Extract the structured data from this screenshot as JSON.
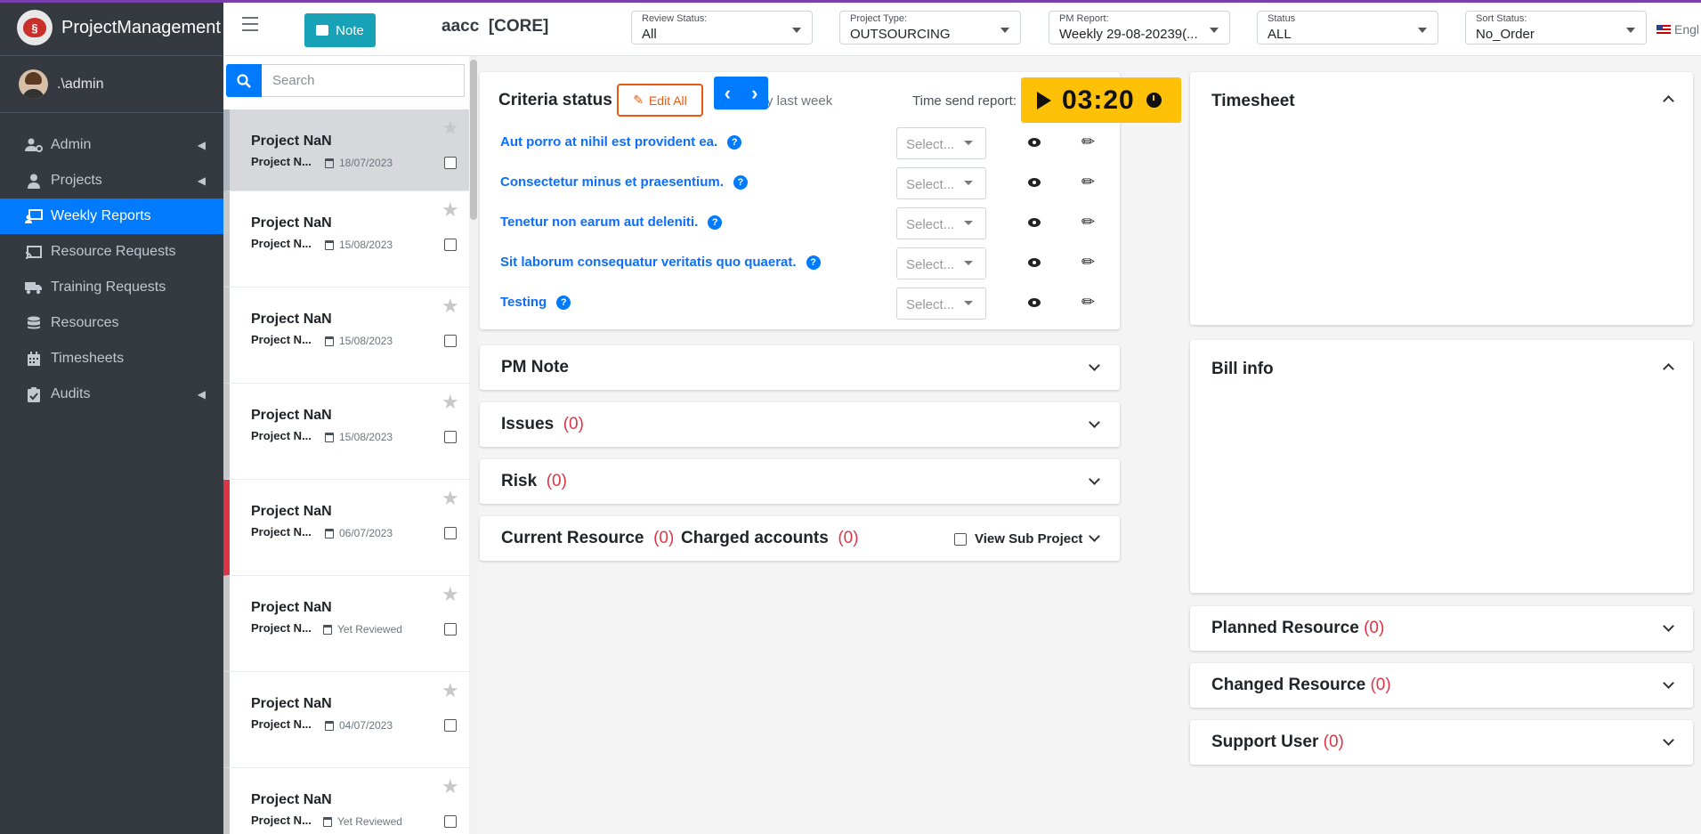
{
  "app": {
    "name": "ProjectManagement"
  },
  "user": {
    "name": ".\\admin"
  },
  "sidebar": {
    "items": [
      {
        "label": "Admin",
        "icon": "users-cog-icon",
        "caret": true,
        "active": false
      },
      {
        "label": "Projects",
        "icon": "user-tie-icon",
        "caret": true,
        "active": false
      },
      {
        "label": "Weekly Reports",
        "icon": "chalkboard-teacher-icon",
        "caret": false,
        "active": true
      },
      {
        "label": "Resource Requests",
        "icon": "cast-icon",
        "caret": false,
        "active": false
      },
      {
        "label": "Training Requests",
        "icon": "truck-icon",
        "caret": false,
        "active": false
      },
      {
        "label": "Resources",
        "icon": "database-icon",
        "caret": false,
        "active": false
      },
      {
        "label": "Timesheets",
        "icon": "calendar-icon",
        "caret": false,
        "active": false
      },
      {
        "label": "Audits",
        "icon": "clipboard-check-icon",
        "caret": true,
        "active": false
      }
    ]
  },
  "topbar": {
    "note_label": "Note",
    "project_title": "aacc  [CORE]",
    "filters": [
      {
        "label": "Review Status:",
        "value": "All"
      },
      {
        "label": "Project Type:",
        "value": "OUTSOURCING"
      },
      {
        "label": "PM Report:",
        "value": "Weekly 29-08-20239(..."
      },
      {
        "label": "Status",
        "value": "ALL"
      },
      {
        "label": "Sort Status:",
        "value": "No_Order"
      }
    ],
    "language": "Engl"
  },
  "search": {
    "placeholder": "Search"
  },
  "projects": [
    {
      "name": "Project NaN",
      "sub": "Project N...",
      "date": "18/07/2023",
      "selected": true,
      "flag": "grey"
    },
    {
      "name": "Project NaN",
      "sub": "Project N...",
      "date": "15/08/2023",
      "selected": false,
      "flag": "grey"
    },
    {
      "name": "Project NaN",
      "sub": "Project N...",
      "date": "15/08/2023",
      "selected": false,
      "flag": "grey"
    },
    {
      "name": "Project NaN",
      "sub": "Project N...",
      "date": "15/08/2023",
      "selected": false,
      "flag": "grey"
    },
    {
      "name": "Project NaN",
      "sub": "Project N...",
      "date": "06/07/2023",
      "selected": false,
      "flag": "red"
    },
    {
      "name": "Project NaN",
      "sub": "Project N...",
      "date": "Yet Reviewed",
      "selected": false,
      "flag": "grey"
    },
    {
      "name": "Project NaN",
      "sub": "Project N...",
      "date": "04/07/2023",
      "selected": false,
      "flag": "grey"
    },
    {
      "name": "Project NaN",
      "sub": "Project N...",
      "date": "Yet Reviewed",
      "selected": false,
      "flag": "grey"
    }
  ],
  "criteria": {
    "title": "Criteria status",
    "edit_all": "Edit All",
    "last_week": "y last week",
    "time_send_label": "Time send report:",
    "timer": "03:20",
    "select_placeholder": "Select...",
    "rows": [
      "Aut porro at nihil est provident ea.",
      "Consectetur minus et praesentium.",
      "Tenetur non earum aut deleniti.",
      "Sit laborum consequatur veritatis quo quaerat.",
      "Testing"
    ]
  },
  "sections": {
    "pm_note": "PM Note",
    "issues": "Issues",
    "issues_count": "(0)",
    "risk": "Risk",
    "risk_count": "(0)",
    "current_resource": "Current Resource",
    "current_resource_count": "(0)",
    "charged_accounts": "Charged accounts",
    "charged_accounts_count": "(0)",
    "view_sub_project": "View Sub Project"
  },
  "right": {
    "timesheet": "Timesheet",
    "bill_info": "Bill info",
    "planned_resource": "Planned Resource",
    "planned_resource_count": "(0)",
    "changed_resource": "Changed Resource",
    "changed_resource_count": "(0)",
    "support_user": "Support User",
    "support_user_count": "(0)"
  },
  "colors": {
    "primary": "#007bff",
    "sidebar": "#343a40",
    "accent_orange": "#e8590c",
    "timer_bg": "#ffc107",
    "count_red": "#dc3545"
  }
}
